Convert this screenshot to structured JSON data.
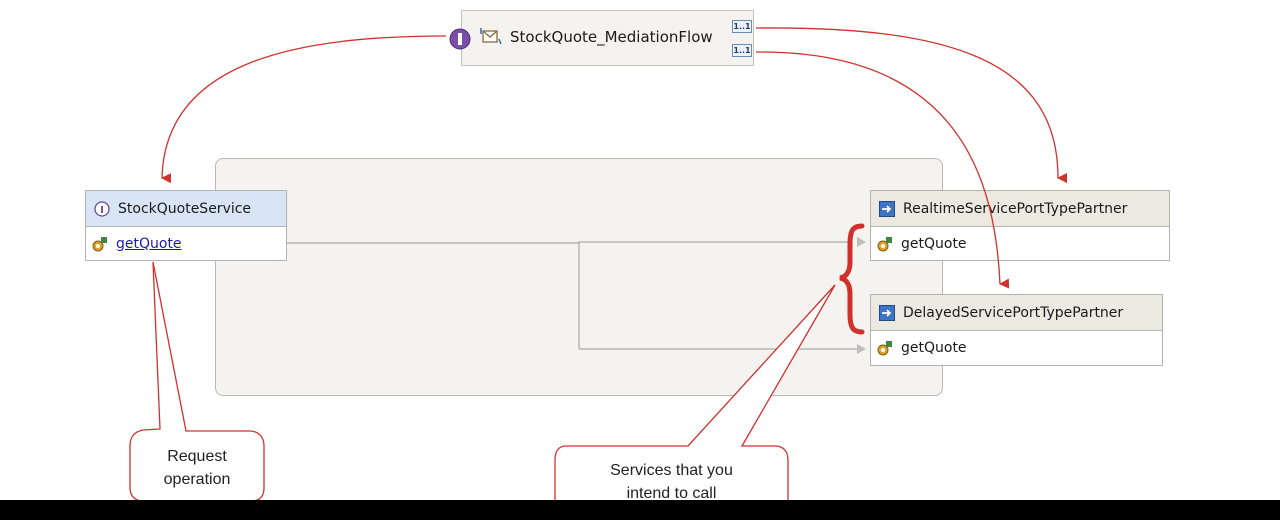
{
  "mediation_flow": {
    "title": "StockQuote_MediationFlow",
    "badge_top": "1..1",
    "badge_bottom": "1..1"
  },
  "export_component": {
    "name": "StockQuoteService",
    "operation": "getQuote"
  },
  "imports": [
    {
      "name": "RealtimeServicePortTypePartner",
      "operation": "getQuote"
    },
    {
      "name": "DelayedServicePortTypePartner",
      "operation": "getQuote"
    }
  ],
  "callouts": {
    "request": [
      "Request",
      "operation"
    ],
    "services": [
      "Services that you",
      "intend to call"
    ]
  },
  "colors": {
    "annotation_red": "#d0312d",
    "interface_blue": "#d9e4f5",
    "partner_beige": "#ebe9e0"
  },
  "icons": [
    "interface-icon",
    "mediation-flow-icon",
    "operation-gear-icon",
    "reference-arrow-icon"
  ]
}
